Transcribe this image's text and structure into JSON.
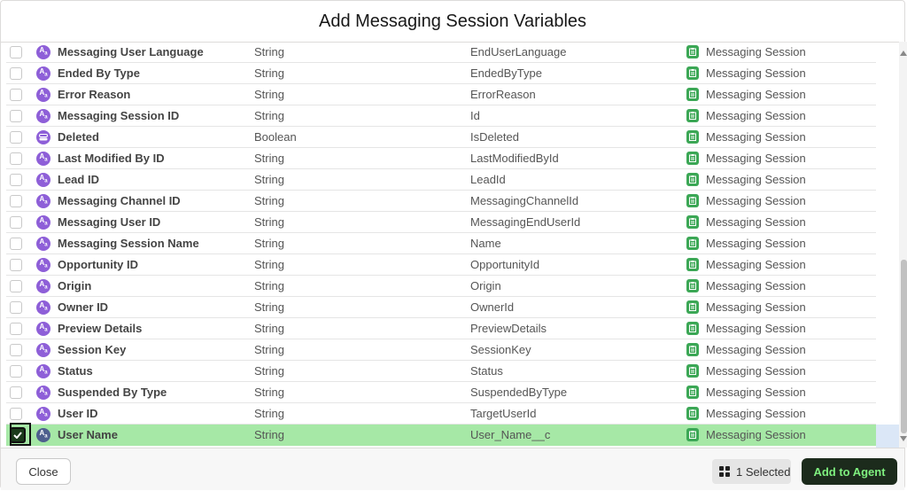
{
  "modal": {
    "title": "Add Messaging Session Variables"
  },
  "rows": [
    {
      "label": "Messaging User Language",
      "type": "String",
      "api": "EndUserLanguage",
      "object": "Messaging Session",
      "icon": "text-type-icon",
      "checked": false
    },
    {
      "label": "Ended By Type",
      "type": "String",
      "api": "EndedByType",
      "object": "Messaging Session",
      "icon": "text-type-icon",
      "checked": false
    },
    {
      "label": "Error Reason",
      "type": "String",
      "api": "ErrorReason",
      "object": "Messaging Session",
      "icon": "text-type-icon",
      "checked": false
    },
    {
      "label": "Messaging Session ID",
      "type": "String",
      "api": "Id",
      "object": "Messaging Session",
      "icon": "text-type-icon",
      "checked": false
    },
    {
      "label": "Deleted",
      "type": "Boolean",
      "api": "IsDeleted",
      "object": "Messaging Session",
      "icon": "boolean-type-icon",
      "checked": false
    },
    {
      "label": "Last Modified By ID",
      "type": "String",
      "api": "LastModifiedById",
      "object": "Messaging Session",
      "icon": "text-type-icon",
      "checked": false
    },
    {
      "label": "Lead ID",
      "type": "String",
      "api": "LeadId",
      "object": "Messaging Session",
      "icon": "text-type-icon",
      "checked": false
    },
    {
      "label": "Messaging Channel ID",
      "type": "String",
      "api": "MessagingChannelId",
      "object": "Messaging Session",
      "icon": "text-type-icon",
      "checked": false
    },
    {
      "label": "Messaging User ID",
      "type": "String",
      "api": "MessagingEndUserId",
      "object": "Messaging Session",
      "icon": "text-type-icon",
      "checked": false
    },
    {
      "label": "Messaging Session Name",
      "type": "String",
      "api": "Name",
      "object": "Messaging Session",
      "icon": "text-type-icon",
      "checked": false
    },
    {
      "label": "Opportunity ID",
      "type": "String",
      "api": "OpportunityId",
      "object": "Messaging Session",
      "icon": "text-type-icon",
      "checked": false
    },
    {
      "label": "Origin",
      "type": "String",
      "api": "Origin",
      "object": "Messaging Session",
      "icon": "text-type-icon",
      "checked": false
    },
    {
      "label": "Owner ID",
      "type": "String",
      "api": "OwnerId",
      "object": "Messaging Session",
      "icon": "text-type-icon",
      "checked": false
    },
    {
      "label": "Preview Details",
      "type": "String",
      "api": "PreviewDetails",
      "object": "Messaging Session",
      "icon": "text-type-icon",
      "checked": false
    },
    {
      "label": "Session Key",
      "type": "String",
      "api": "SessionKey",
      "object": "Messaging Session",
      "icon": "text-type-icon",
      "checked": false
    },
    {
      "label": "Status",
      "type": "String",
      "api": "Status",
      "object": "Messaging Session",
      "icon": "text-type-icon",
      "checked": false
    },
    {
      "label": "Suspended By Type",
      "type": "String",
      "api": "SuspendedByType",
      "object": "Messaging Session",
      "icon": "text-type-icon",
      "checked": false
    },
    {
      "label": "User ID",
      "type": "String",
      "api": "TargetUserId",
      "object": "Messaging Session",
      "icon": "text-type-icon",
      "checked": false
    },
    {
      "label": "User Name",
      "type": "String",
      "api": "User_Name__c",
      "object": "Messaging Session",
      "icon": "text-type-icon",
      "checked": true
    }
  ],
  "footer": {
    "close_label": "Close",
    "selected_label": "1 Selected",
    "add_label": "Add to Agent"
  },
  "colors": {
    "type_icon": "#8e5fd8",
    "object_icon": "#3ba755",
    "selected_row": "#a6e8a6",
    "add_button_bg": "#1c2b1c",
    "add_button_text": "#7ff07f"
  }
}
